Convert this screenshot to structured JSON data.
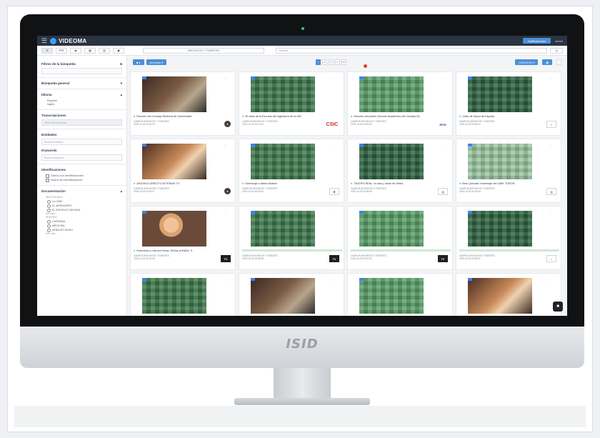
{
  "app": {
    "brand": "VIDEOMA",
    "notifications_label": "Notificaciones",
    "user_label": "admin"
  },
  "toolbar": {
    "views": [
      "☰",
      "☰☰",
      "◉",
      "▦",
      "▤",
      "▣"
    ],
    "collection": "ARCHIVOS Y FUENTES",
    "search_placeholder": "Buscar",
    "search_button": "Q"
  },
  "chin": {
    "logo": "ISID"
  },
  "sidebar": {
    "filters_title": "Filtros de la búsqueda",
    "general_search": "Búsqueda general",
    "language_title": "Idioma",
    "languages": [
      "Español",
      "Inglés"
    ],
    "transcriptions_title": "Transcripciones",
    "transcriptions_placeholder": "Texto de la prueba",
    "entities_title": "Entidades",
    "entities_placeholder": "Buscar Entidad",
    "keywords_title": "Keywords",
    "keywords_placeholder": "Buscar Keyword",
    "identifications_title": "Identificaciones",
    "identifications": [
      "Videos con identificaciones",
      "Videos sin identificaciones"
    ],
    "documentation_title": "Documentación",
    "group1_label": "SINTITULADA",
    "group1_items": [
      "LA CAÍM",
      "EL MENSAJERO",
      "EL ARCHIVO CÁNTARA"
    ],
    "more1": "Ver más...",
    "group2_label": "SENTIDO",
    "group2_items": [
      "CARMONA",
      "MEDICINA",
      "SEÑALES RADIO"
    ],
    "more2": "Ver más..."
  },
  "content": {
    "left_btn": "■ ▾",
    "filter_btn": "Archivos ▾",
    "pages": [
      "«",
      "1",
      "2",
      "»",
      "»»"
    ],
    "sort_btn": "CÓDIGOS ▾",
    "view_btn": "▦",
    "more_btn": "⋮"
  },
  "cards": [
    {
      "thumb": "photo1",
      "dot": "#e53935",
      "title": "Reunión del Consejo Rectoral de Universidad",
      "meta1": "CAMPUS   ARCHIVOS Y FUENTES",
      "meta2": "2019-10-15  00:51:23",
      "chan": "round",
      "chan_text": "●"
    },
    {
      "thumb": "green1",
      "dot": "#43a047",
      "title": "25 años de la Escuela del Ingeniería de la UNI",
      "meta1": "CAMPUS   ARCHIVOS Y FUENTES",
      "meta2": "2019-10-15  00:01:06",
      "chan": "csic",
      "chan_text": "CSIC"
    },
    {
      "thumb": "green2",
      "dot": "#43a047",
      "title": "Reunión del primer Decreto Académico del Consejo Es",
      "meta1": "CAMPUS   ARCHIVOS Y FUENTES",
      "meta2": "2019-10-15  00:49:09",
      "chan": "epsi",
      "chan_text": "EPSI"
    },
    {
      "thumb": "green3",
      "dot": "#1e88e5",
      "title": "Vinilo de Sacra de España",
      "meta1": "CAMPUS   ARCHIVOS Y FUENTES",
      "meta2": "2019-10-15  00:38:12",
      "chan": "badge",
      "chan_text": "⌂"
    },
    {
      "thumb": "photo2",
      "dot": "#43a047",
      "title": "ARCHIVO DIRECTO ALTERIAS TV",
      "meta1": "CAMPUS   ARCHIVOS Y FUENTES",
      "meta2": "2019-10-15  00:49:47",
      "chan": "round",
      "chan_text": "●"
    },
    {
      "thumb": "green1",
      "dot": "#43a047",
      "title": "Homenaje a María Moliner",
      "meta1": "CAMPUS   ARCHIVOS Y FUENTES",
      "meta2": "2019-10-15  00:04:05",
      "chan": "badge",
      "chan_text": "⧗"
    },
    {
      "thumb": "green3",
      "dot": "#43a047",
      "title": "TEATRO REAL: la vida y obras de Ofelia",
      "meta1": "CAMPUS   ARCHIVOS Y FUENTES",
      "meta2": "2019-10-15  00:08:08",
      "chan": "badge",
      "chan_text": "Q"
    },
    {
      "thumb": "pale",
      "dot": "#1e88e5",
      "title": "Belo Quixotal: Homenaje del 1860: TURON",
      "meta1": "CAMPUS   ARCHIVOS Y FUENTES",
      "meta2": "2019-10-15  00:29:05",
      "chan": "badge",
      "chan_text": "Q"
    },
    {
      "thumb": "photo3",
      "dot": "#43a047",
      "title": "Entrevista a Carmen Recio: Señas al Edifici. S",
      "meta1": "CAMPUS   ARCHIVOS Y FUENTES",
      "meta2": "2019-10-15  00:12:08",
      "chan": "dark",
      "chan_text": "TV"
    },
    {
      "thumb": "green1",
      "dot": "#43a047",
      "title": "",
      "meta1": "CAMPUS   ARCHIVOS Y FUENTES",
      "meta2": "2019-10-15  00:08:08",
      "chan": "dark",
      "chan_text": "TV"
    },
    {
      "thumb": "green2",
      "dot": "#43a047",
      "title": "",
      "meta1": "CAMPUS   ARCHIVOS Y FUENTES",
      "meta2": "2019-10-15  00:20:21",
      "chan": "dark",
      "chan_text": "TV"
    },
    {
      "thumb": "green3",
      "dot": "#43a047",
      "title": "",
      "meta1": "CAMPUS   ARCHIVOS Y FUENTES",
      "meta2": "2019-10-15  00:08:07",
      "chan": "badge",
      "chan_text": "⌂"
    },
    {
      "thumb": "green1",
      "dot": "#43a047",
      "title": "",
      "meta1": "",
      "meta2": "",
      "chan": "",
      "chan_text": ""
    },
    {
      "thumb": "photo1",
      "dot": "#43a047",
      "title": "",
      "meta1": "",
      "meta2": "",
      "chan": "",
      "chan_text": ""
    },
    {
      "thumb": "green2",
      "dot": "#43a047",
      "title": "",
      "meta1": "",
      "meta2": "",
      "chan": "",
      "chan_text": ""
    },
    {
      "thumb": "photo2",
      "dot": "#43a047",
      "title": "",
      "meta1": "",
      "meta2": "",
      "chan": "",
      "chan_text": ""
    }
  ]
}
